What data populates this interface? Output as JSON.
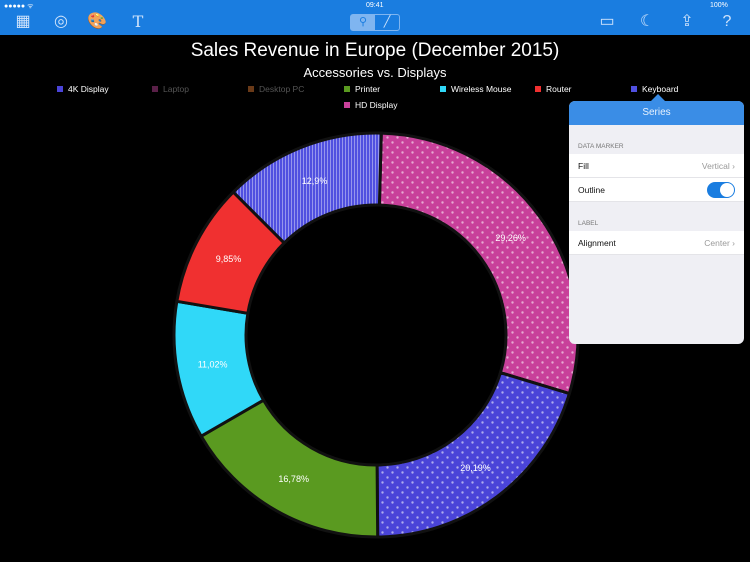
{
  "status": {
    "signal": "●●●●● ᯤ",
    "time": "09:41",
    "battery": "100%"
  },
  "toolbar": {
    "grid": "▦",
    "ring": "◎",
    "palette": "🎨",
    "text": "T",
    "zoom": "⚲",
    "pen": "╱",
    "window": "▭",
    "night": "☾",
    "share": "⇪",
    "help": "?"
  },
  "chart_data": {
    "type": "pie",
    "title": "Sales Revenue in Europe (December 2015)",
    "subtitle": "Accessories vs. Displays",
    "legend": [
      {
        "name": "4K Display",
        "color": "#4a44d8",
        "visible": true
      },
      {
        "name": "Laptop",
        "color": "#5a2048",
        "visible": false
      },
      {
        "name": "Desktop PC",
        "color": "#6a3a18",
        "visible": false
      },
      {
        "name": "Printer",
        "color": "#5a9a20",
        "visible": true
      },
      {
        "name": "Wireless Mouse",
        "color": "#30d8f8",
        "visible": true
      },
      {
        "name": "Router",
        "color": "#f03030",
        "visible": true
      },
      {
        "name": "Keyboard",
        "color": "#5050e0",
        "visible": true
      },
      {
        "name": "HD Display",
        "color": "#c8409a",
        "visible": true
      }
    ],
    "slices": [
      {
        "name": "HD Display",
        "value": 29.26,
        "label": "29,26%",
        "color": "#c8409a",
        "pattern": "dots"
      },
      {
        "name": "4K Display",
        "value": 20.19,
        "label": "20,19%",
        "color": "#4a44d8",
        "pattern": "dots"
      },
      {
        "name": "Printer",
        "value": 16.78,
        "label": "16,78%",
        "color": "#5a9a20",
        "pattern": "none"
      },
      {
        "name": "Wireless Mouse",
        "value": 11.02,
        "label": "11,02%",
        "color": "#30d8f8",
        "pattern": "none"
      },
      {
        "name": "Router",
        "value": 9.85,
        "label": "9,85%",
        "color": "#f03030",
        "pattern": "none"
      },
      {
        "name": "Keyboard",
        "value": 12.9,
        "label": "12,9%",
        "color": "#5050e0",
        "pattern": "vertical"
      }
    ]
  },
  "popover": {
    "title": "Series",
    "section1": "DATA MARKER",
    "fill_label": "Fill",
    "fill_value": "Vertical",
    "outline_label": "Outline",
    "outline_on": true,
    "section2": "LABEL",
    "align_label": "Alignment",
    "align_value": "Center"
  }
}
